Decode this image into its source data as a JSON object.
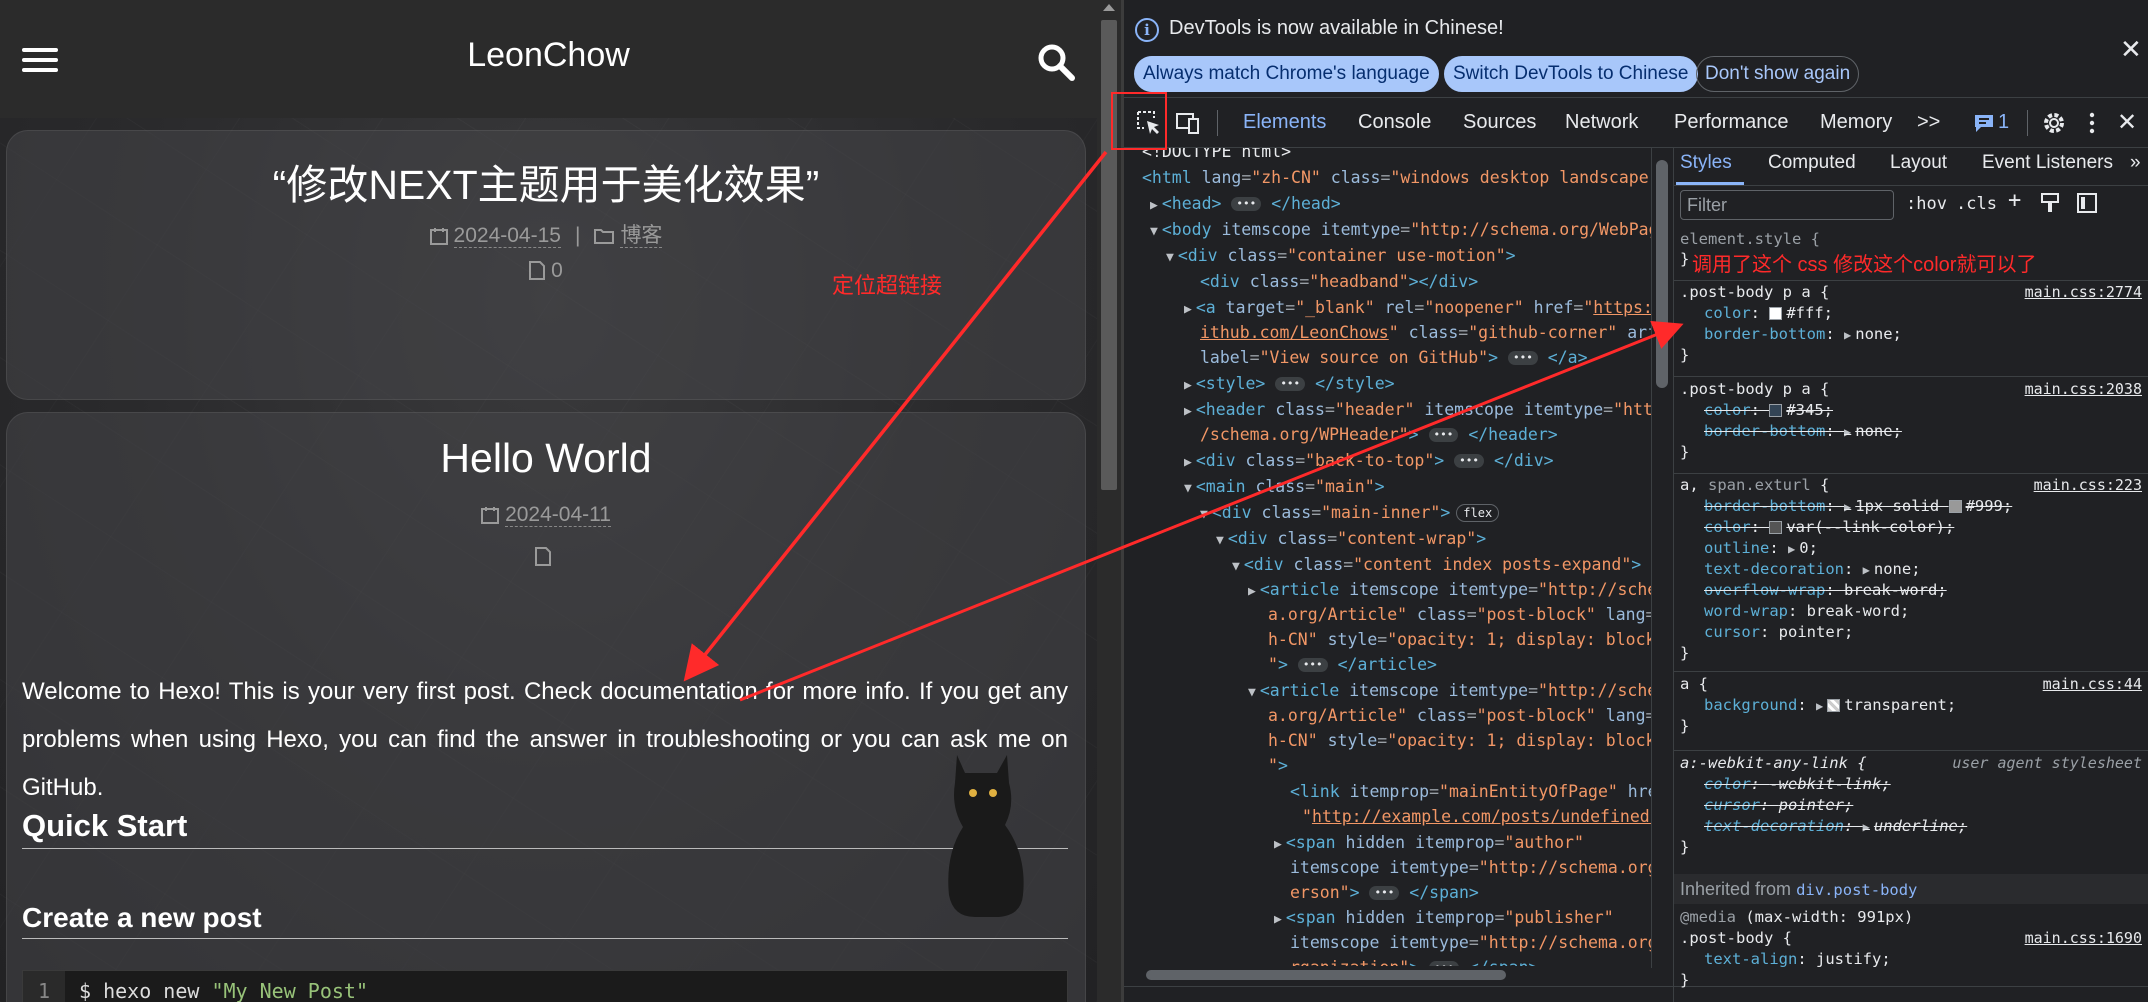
{
  "blog": {
    "site_title": "LeonChow",
    "post1": {
      "title": "“修改NEXT主题用于美化效果”",
      "date": "2024-04-15",
      "category": "博客",
      "words": "0"
    },
    "annotation_locate": "定位超链接",
    "post2": {
      "title": "Hello World",
      "date": "2024-04-11",
      "body": "Welcome to Hexo! This is your very first post. Check documentation for more info. If you get any problems when using Hexo, you can find the answer in troubleshooting or you can ask me on GitHub.",
      "h2_quick_start": "Quick Start",
      "h3_create_post": "Create a new post",
      "code_line_number": "1",
      "code_cmd": "$ hexo new ",
      "code_str": "\"My New Post\""
    }
  },
  "devtools": {
    "info_text": "DevTools is now available in Chinese!",
    "btn_match": "Always match Chrome's language",
    "btn_switch": "Switch DevTools to Chinese",
    "btn_dont_show": "Don't show again",
    "tabs": [
      "Elements",
      "Console",
      "Sources",
      "Network",
      "Performance",
      "Memory"
    ],
    "more_tabs": ">>",
    "issues_count": "1",
    "styles_tabs": [
      "Styles",
      "Computed",
      "Layout",
      "Event Listeners"
    ],
    "filter_placeholder": "Filter",
    "hov": ":hov",
    "cls": ".cls",
    "styles_annotation": "调用了这个 css 修改这个color就可以了",
    "inherited_label": "Inherited from",
    "inherited_from": "div.post-body",
    "colors": {
      "accent": "#8ab4f8",
      "annotation_red": "#ff2a2a",
      "tag": "#5db0d7",
      "attr_value": "#f29766"
    }
  }
}
